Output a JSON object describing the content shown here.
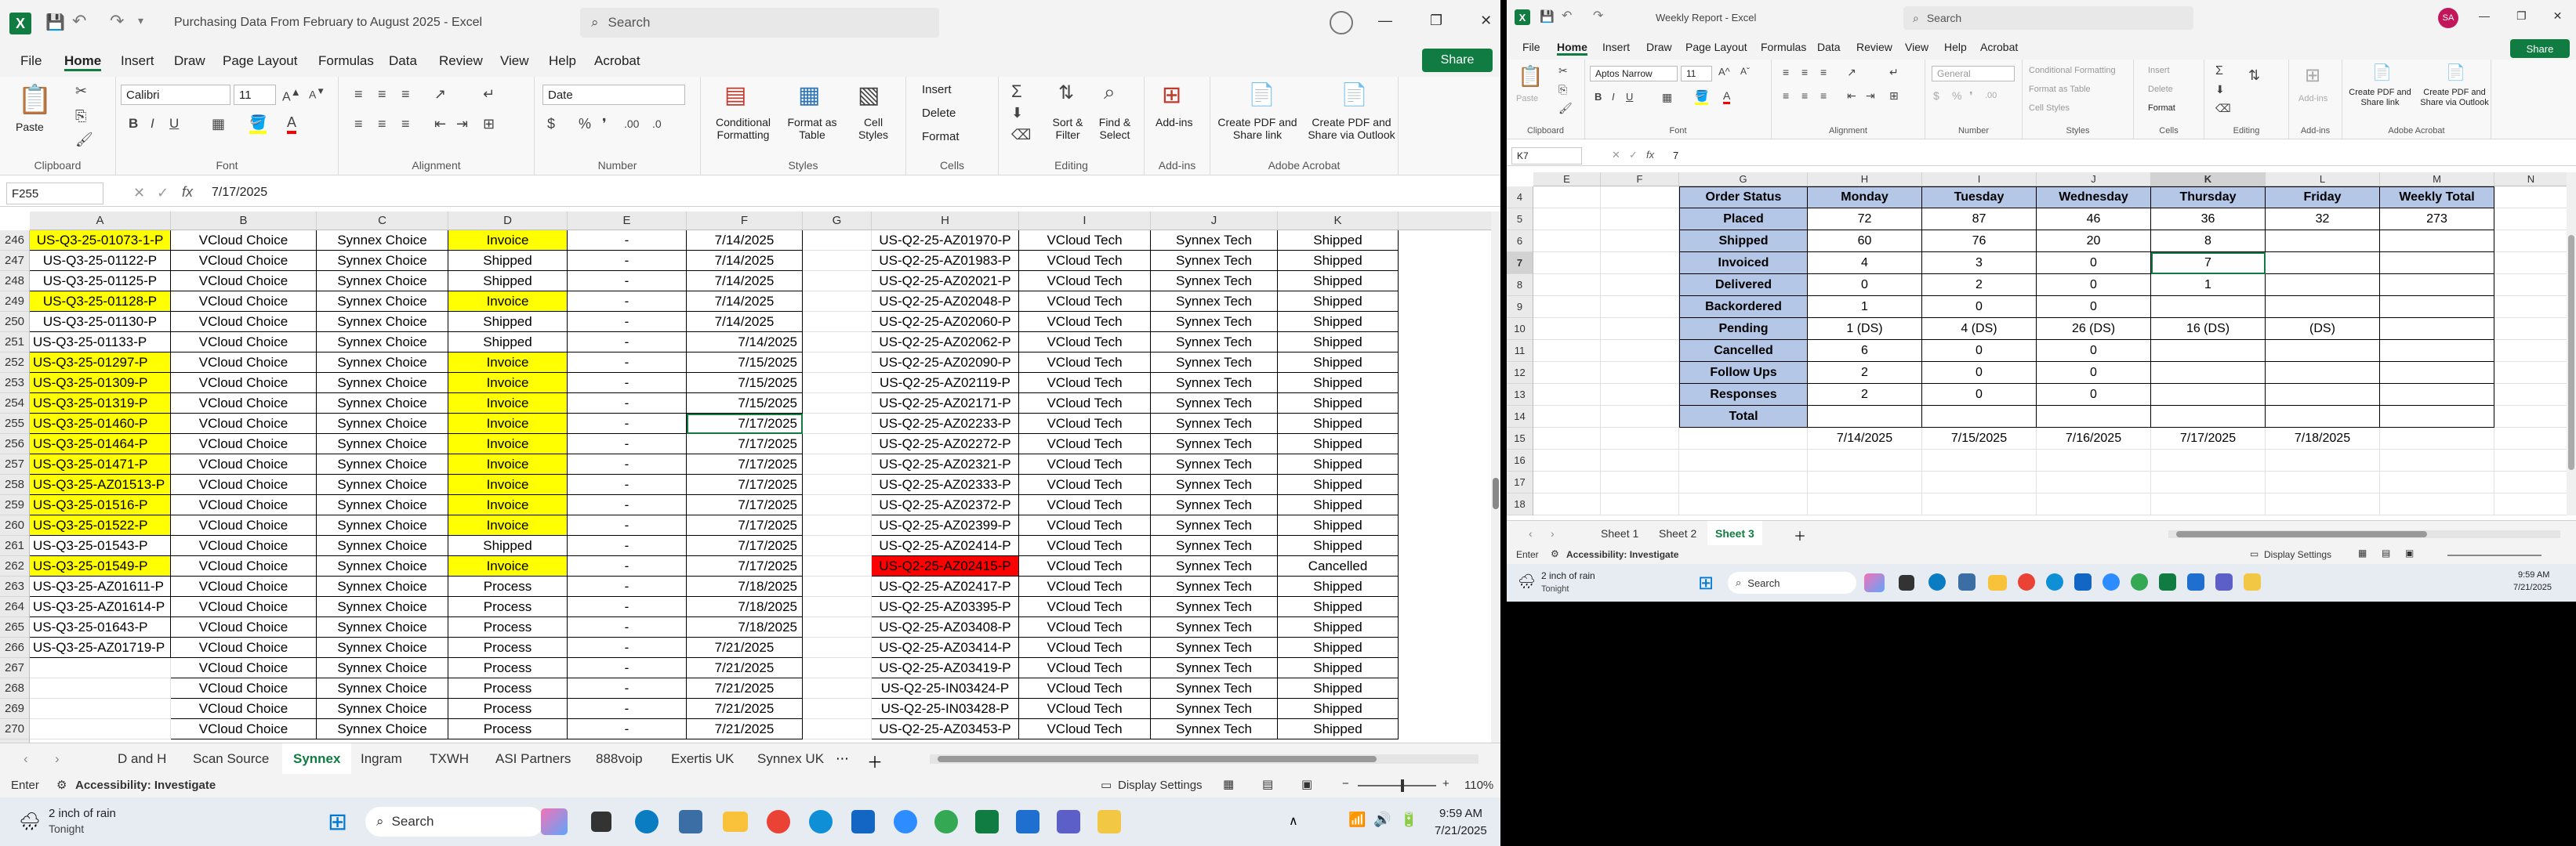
{
  "left": {
    "title": "Purchasing Data From February to August 2025  -  Excel",
    "search_placeholder": "Search",
    "menu": [
      "File",
      "Home",
      "Insert",
      "Draw",
      "Page Layout",
      "Formulas",
      "Data",
      "Review",
      "View",
      "Help",
      "Acrobat"
    ],
    "share": "Share",
    "ribbon": {
      "paste": "Paste",
      "clipboard": "Clipboard",
      "font_name": "Calibri",
      "font_size": "11",
      "font": "Font",
      "alignment": "Alignment",
      "number_format": "Date",
      "number": "Number",
      "cond_fmt": "Conditional Formatting",
      "format_table": "Format as Table",
      "cell_styles": "Cell Styles",
      "styles": "Styles",
      "insert": "Insert",
      "delete": "Delete",
      "format": "Format",
      "cells": "Cells",
      "sort": "Sort & Filter",
      "find": "Find & Select",
      "editing": "Editing",
      "addins": "Add-ins",
      "addins_grp": "Add-ins",
      "pdf_link": "Create PDF and Share link",
      "pdf_outlook": "Create PDF and Share via Outlook",
      "acrobat": "Adobe Acrobat"
    },
    "name_box": "F255",
    "formula": "7/17/2025",
    "col_headers": [
      "A",
      "B",
      "C",
      "D",
      "E",
      "F",
      "G",
      "H",
      "I",
      "J",
      "K"
    ],
    "rows": [
      {
        "n": "246",
        "a": "US-Q3-25-01073-1-P",
        "ay": true,
        "b": "VCloud Choice",
        "c": "Synnex Choice",
        "d": "Invoice",
        "dy": true,
        "e": "-",
        "f": "7/14/2025",
        "fb": true,
        "h": "US-Q2-25-AZ01970-P",
        "i": "VCloud Tech",
        "j": "Synnex Tech",
        "k": "Shipped"
      },
      {
        "n": "247",
        "a": "US-Q3-25-01122-P",
        "b": "VCloud Choice",
        "c": "Synnex Choice",
        "d": "Shipped",
        "e": "-",
        "f": "7/14/2025",
        "fb": true,
        "h": "US-Q2-25-AZ01983-P",
        "i": "VCloud Tech",
        "j": "Synnex Tech",
        "k": "Shipped"
      },
      {
        "n": "248",
        "a": "US-Q3-25-01125-P",
        "b": "VCloud Choice",
        "c": "Synnex Choice",
        "d": "Shipped",
        "e": "-",
        "f": "7/14/2025",
        "fb": true,
        "h": "US-Q2-25-AZ02021-P",
        "i": "VCloud Tech",
        "j": "Synnex Tech",
        "k": "Shipped"
      },
      {
        "n": "249",
        "a": "US-Q3-25-01128-P",
        "ay": true,
        "b": "VCloud Choice",
        "c": "Synnex Choice",
        "d": "Invoice",
        "dy": true,
        "e": "-",
        "f": "7/14/2025",
        "fb": true,
        "h": "US-Q2-25-AZ02048-P",
        "i": "VCloud Tech",
        "j": "Synnex Tech",
        "k": "Shipped"
      },
      {
        "n": "250",
        "a": "US-Q3-25-01130-P",
        "b": "VCloud Choice",
        "c": "Synnex Choice",
        "d": "Shipped",
        "e": "-",
        "f": "7/14/2025",
        "fb": true,
        "h": "US-Q2-25-AZ02060-P",
        "i": "VCloud Tech",
        "j": "Synnex Tech",
        "k": "Shipped"
      },
      {
        "n": "251",
        "a": "US-Q3-25-01133-P",
        "al": true,
        "b": "VCloud Choice",
        "c": "Synnex Choice",
        "d": "Shipped",
        "e": "-",
        "f": "7/14/2025",
        "fr": true,
        "h": "US-Q2-25-AZ02062-P",
        "i": "VCloud Tech",
        "j": "Synnex Tech",
        "k": "Shipped"
      },
      {
        "n": "252",
        "a": "US-Q3-25-01297-P",
        "ay": true,
        "al": true,
        "b": "VCloud Choice",
        "c": "Synnex Choice",
        "d": "Invoice",
        "dy": true,
        "e": "-",
        "f": "7/15/2025",
        "fr": true,
        "h": "US-Q2-25-AZ02090-P",
        "i": "VCloud Tech",
        "j": "Synnex Tech",
        "k": "Shipped"
      },
      {
        "n": "253",
        "a": "US-Q3-25-01309-P",
        "ay": true,
        "al": true,
        "b": "VCloud Choice",
        "c": "Synnex Choice",
        "d": "Invoice",
        "dy": true,
        "e": "-",
        "f": "7/15/2025",
        "fr": true,
        "h": "US-Q2-25-AZ02119-P",
        "i": "VCloud Tech",
        "j": "Synnex Tech",
        "k": "Shipped"
      },
      {
        "n": "254",
        "a": "US-Q3-25-01319-P",
        "ay": true,
        "al": true,
        "b": "VCloud Choice",
        "c": "Synnex Choice",
        "d": "Invoice",
        "dy": true,
        "e": "-",
        "f": "7/15/2025",
        "fr": true,
        "h": "US-Q2-25-AZ02171-P",
        "i": "VCloud Tech",
        "j": "Synnex Tech",
        "k": "Shipped"
      },
      {
        "n": "255",
        "a": "US-Q3-25-01460-P",
        "ay": true,
        "al": true,
        "b": "VCloud Choice",
        "c": "Synnex Choice",
        "d": "Invoice",
        "dy": true,
        "e": "-",
        "f": "7/17/2025",
        "fr": true,
        "h": "US-Q2-25-AZ02233-P",
        "i": "VCloud Tech",
        "j": "Synnex Tech",
        "k": "Shipped"
      },
      {
        "n": "256",
        "a": "US-Q3-25-01464-P",
        "ay": true,
        "al": true,
        "b": "VCloud Choice",
        "c": "Synnex Choice",
        "d": "Invoice",
        "dy": true,
        "e": "-",
        "f": "7/17/2025",
        "fr": true,
        "h": "US-Q2-25-AZ02272-P",
        "i": "VCloud Tech",
        "j": "Synnex Tech",
        "k": "Shipped"
      },
      {
        "n": "257",
        "a": "US-Q3-25-01471-P",
        "ay": true,
        "al": true,
        "b": "VCloud Choice",
        "c": "Synnex Choice",
        "d": "Invoice",
        "dy": true,
        "e": "-",
        "f": "7/17/2025",
        "fr": true,
        "h": "US-Q2-25-AZ02321-P",
        "i": "VCloud Tech",
        "j": "Synnex Tech",
        "k": "Shipped"
      },
      {
        "n": "258",
        "a": "US-Q3-25-AZ01513-P",
        "ay": true,
        "al": true,
        "b": "VCloud Choice",
        "c": "Synnex Choice",
        "d": "Invoice",
        "dy": true,
        "e": "-",
        "f": "7/17/2025",
        "fr": true,
        "h": "US-Q2-25-AZ02333-P",
        "i": "VCloud Tech",
        "j": "Synnex Tech",
        "k": "Shipped"
      },
      {
        "n": "259",
        "a": "US-Q3-25-01516-P",
        "ay": true,
        "al": true,
        "b": "VCloud Choice",
        "c": "Synnex Choice",
        "d": "Invoice",
        "dy": true,
        "e": "-",
        "f": "7/17/2025",
        "fr": true,
        "h": "US-Q2-25-AZ02372-P",
        "i": "VCloud Tech",
        "j": "Synnex Tech",
        "k": "Shipped"
      },
      {
        "n": "260",
        "a": "US-Q3-25-01522-P",
        "ay": true,
        "al": true,
        "b": "VCloud Choice",
        "c": "Synnex Choice",
        "d": "Invoice",
        "dy": true,
        "e": "-",
        "f": "7/17/2025",
        "fr": true,
        "h": "US-Q2-25-AZ02399-P",
        "i": "VCloud Tech",
        "j": "Synnex Tech",
        "k": "Shipped"
      },
      {
        "n": "261",
        "a": "US-Q3-25-01543-P",
        "al": true,
        "b": "VCloud Choice",
        "c": "Synnex Choice",
        "d": "Shipped",
        "e": "-",
        "f": "7/17/2025",
        "fr": true,
        "h": "US-Q2-25-AZ02414-P",
        "i": "VCloud Tech",
        "j": "Synnex Tech",
        "k": "Shipped"
      },
      {
        "n": "262",
        "a": "US-Q3-25-01549-P",
        "ay": true,
        "al": true,
        "b": "VCloud Choice",
        "c": "Synnex Choice",
        "d": "Invoice",
        "dy": true,
        "e": "-",
        "f": "7/17/2025",
        "fr": true,
        "h": "US-Q2-25-AZ02415-P",
        "hr": true,
        "i": "VCloud Tech",
        "j": "Synnex Tech",
        "k": "Cancelled"
      },
      {
        "n": "263",
        "a": "US-Q3-25-AZ01611-P",
        "al": true,
        "b": "VCloud Choice",
        "c": "Synnex Choice",
        "d": "Process",
        "e": "-",
        "f": "7/18/2025",
        "fr": true,
        "h": "US-Q2-25-AZ02417-P",
        "i": "VCloud Tech",
        "j": "Synnex Tech",
        "k": "Shipped"
      },
      {
        "n": "264",
        "a": "US-Q3-25-AZ01614-P",
        "al": true,
        "b": "VCloud Choice",
        "c": "Synnex Choice",
        "d": "Process",
        "e": "-",
        "f": "7/18/2025",
        "fr": true,
        "h": "US-Q2-25-AZ03395-P",
        "i": "VCloud Tech",
        "j": "Synnex Tech",
        "k": "Shipped"
      },
      {
        "n": "265",
        "a": "US-Q3-25-01643-P",
        "al": true,
        "b": "VCloud Choice",
        "c": "Synnex Choice",
        "d": "Process",
        "e": "-",
        "f": "7/18/2025",
        "fr": true,
        "h": "US-Q2-25-AZ03408-P",
        "i": "VCloud Tech",
        "j": "Synnex Tech",
        "k": "Shipped"
      },
      {
        "n": "266",
        "a": "US-Q3-25-AZ01719-P",
        "al": true,
        "b": "VCloud Choice",
        "c": "Synnex Choice",
        "d": "Process",
        "e": "-",
        "f": "7/21/2025",
        "fb": true,
        "h": "US-Q2-25-AZ03414-P",
        "i": "VCloud Tech",
        "j": "Synnex Tech",
        "k": "Shipped"
      },
      {
        "n": "267",
        "a": "",
        "b": "VCloud Choice",
        "c": "Synnex Choice",
        "d": "Process",
        "e": "-",
        "f": "7/21/2025",
        "fb": true,
        "h": "US-Q2-25-AZ03419-P",
        "i": "VCloud Tech",
        "j": "Synnex Tech",
        "k": "Shipped"
      },
      {
        "n": "268",
        "a": "",
        "b": "VCloud Choice",
        "c": "Synnex Choice",
        "d": "Process",
        "e": "-",
        "f": "7/21/2025",
        "fb": true,
        "h": "US-Q2-25-IN03424-P",
        "i": "VCloud Tech",
        "j": "Synnex Tech",
        "k": "Shipped"
      },
      {
        "n": "269",
        "a": "",
        "b": "VCloud Choice",
        "c": "Synnex Choice",
        "d": "Process",
        "e": "-",
        "f": "7/21/2025",
        "fb": true,
        "h": "US-Q2-25-IN03428-P",
        "i": "VCloud Tech",
        "j": "Synnex Tech",
        "k": "Shipped"
      },
      {
        "n": "270",
        "a": "",
        "b": "VCloud Choice",
        "c": "Synnex Choice",
        "d": "Process",
        "e": "-",
        "f": "7/21/2025",
        "fb": true,
        "h": "US-Q2-25-AZ03453-P",
        "i": "VCloud Tech",
        "j": "Synnex Tech",
        "k": "Shipped"
      }
    ],
    "tabs": [
      "D and H",
      "Scan Source",
      "Synnex",
      "Ingram",
      "TXWH",
      "ASI Partners",
      "888voip",
      "Exertis UK",
      "Synnex UK"
    ],
    "active_tab": "Synnex",
    "status_mode": "Enter",
    "accessibility": "Accessibility: Investigate",
    "display_settings": "Display Settings",
    "zoom": "110%"
  },
  "right": {
    "title": "Weekly Report  -  Excel",
    "search_placeholder": "Search",
    "avatar": "SA",
    "menu": [
      "File",
      "Home",
      "Insert",
      "Draw",
      "Page Layout",
      "Formulas",
      "Data",
      "Review",
      "View",
      "Help",
      "Acrobat"
    ],
    "share": "Share",
    "ribbon": {
      "paste": "Paste",
      "clipboard": "Clipboard",
      "font_name": "Aptos Narrow",
      "font_size": "11",
      "font": "Font",
      "alignment": "Alignment",
      "number_format": "General",
      "number": "Number",
      "cond_fmt": "Conditional Formatting",
      "format_table": "Format as Table",
      "cell_styles": "Cell Styles",
      "styles": "Styles",
      "insert": "Insert",
      "delete": "Delete",
      "format": "Format",
      "cells": "Cells",
      "editing": "Editing",
      "addins": "Add-ins",
      "addins_grp": "Add-ins",
      "pdf_link": "Create PDF and Share link",
      "pdf_outlook": "Create PDF and Share via Outlook",
      "acrobat": "Adobe Acrobat"
    },
    "name_box": "K7",
    "formula": "7",
    "col_headers": [
      "E",
      "F",
      "G",
      "H",
      "I",
      "J",
      "K",
      "L",
      "M",
      "N"
    ],
    "row_numbers": [
      "4",
      "5",
      "6",
      "7",
      "8",
      "9",
      "10",
      "11",
      "12",
      "13",
      "14",
      "15",
      "16",
      "17",
      "18"
    ],
    "table": {
      "header": [
        "Order Status",
        "Monday",
        "Tuesday",
        "Wednesday",
        "Thursday",
        "Friday",
        "Weekly Total"
      ],
      "rows": [
        [
          "Placed",
          "72",
          "87",
          "46",
          "36",
          "32",
          "273"
        ],
        [
          "Shipped",
          "60",
          "76",
          "20",
          "8",
          "",
          ""
        ],
        [
          "Invoiced",
          "4",
          "3",
          "0",
          "7",
          "",
          ""
        ],
        [
          "Delivered",
          "0",
          "2",
          "0",
          "1",
          "",
          ""
        ],
        [
          "Backordered",
          "1",
          "0",
          "0",
          "",
          "",
          ""
        ],
        [
          "Pending",
          "1 (DS)",
          "4 (DS)",
          "26 (DS)",
          "16 (DS)",
          "(DS)",
          ""
        ],
        [
          "Cancelled",
          "6",
          "0",
          "0",
          "",
          "",
          ""
        ],
        [
          "Follow Ups",
          "2",
          "0",
          "0",
          "",
          "",
          ""
        ],
        [
          "Responses",
          "2",
          "0",
          "0",
          "",
          "",
          ""
        ],
        [
          "Total",
          "",
          "",
          "",
          "",
          "",
          ""
        ]
      ],
      "dates": [
        "7/14/2025",
        "7/15/2025",
        "7/16/2025",
        "7/17/2025",
        "7/18/2025"
      ]
    },
    "tabs": [
      "Sheet 1",
      "Sheet 2",
      "Sheet 3"
    ],
    "active_tab": "Sheet 3",
    "status_mode": "Enter",
    "accessibility": "Accessibility: Investigate",
    "display_settings": "Display Settings"
  },
  "taskbar_left": {
    "weather_temp": "2 inch of rain",
    "weather_sub": "Tonight",
    "search": "Search",
    "time": "9:59 AM",
    "date": "7/21/2025"
  },
  "taskbar_right": {
    "weather_temp": "2 inch of rain",
    "weather_sub": "Tonight",
    "search": "Search",
    "time": "9:59 AM",
    "date": "7/21/2025"
  }
}
